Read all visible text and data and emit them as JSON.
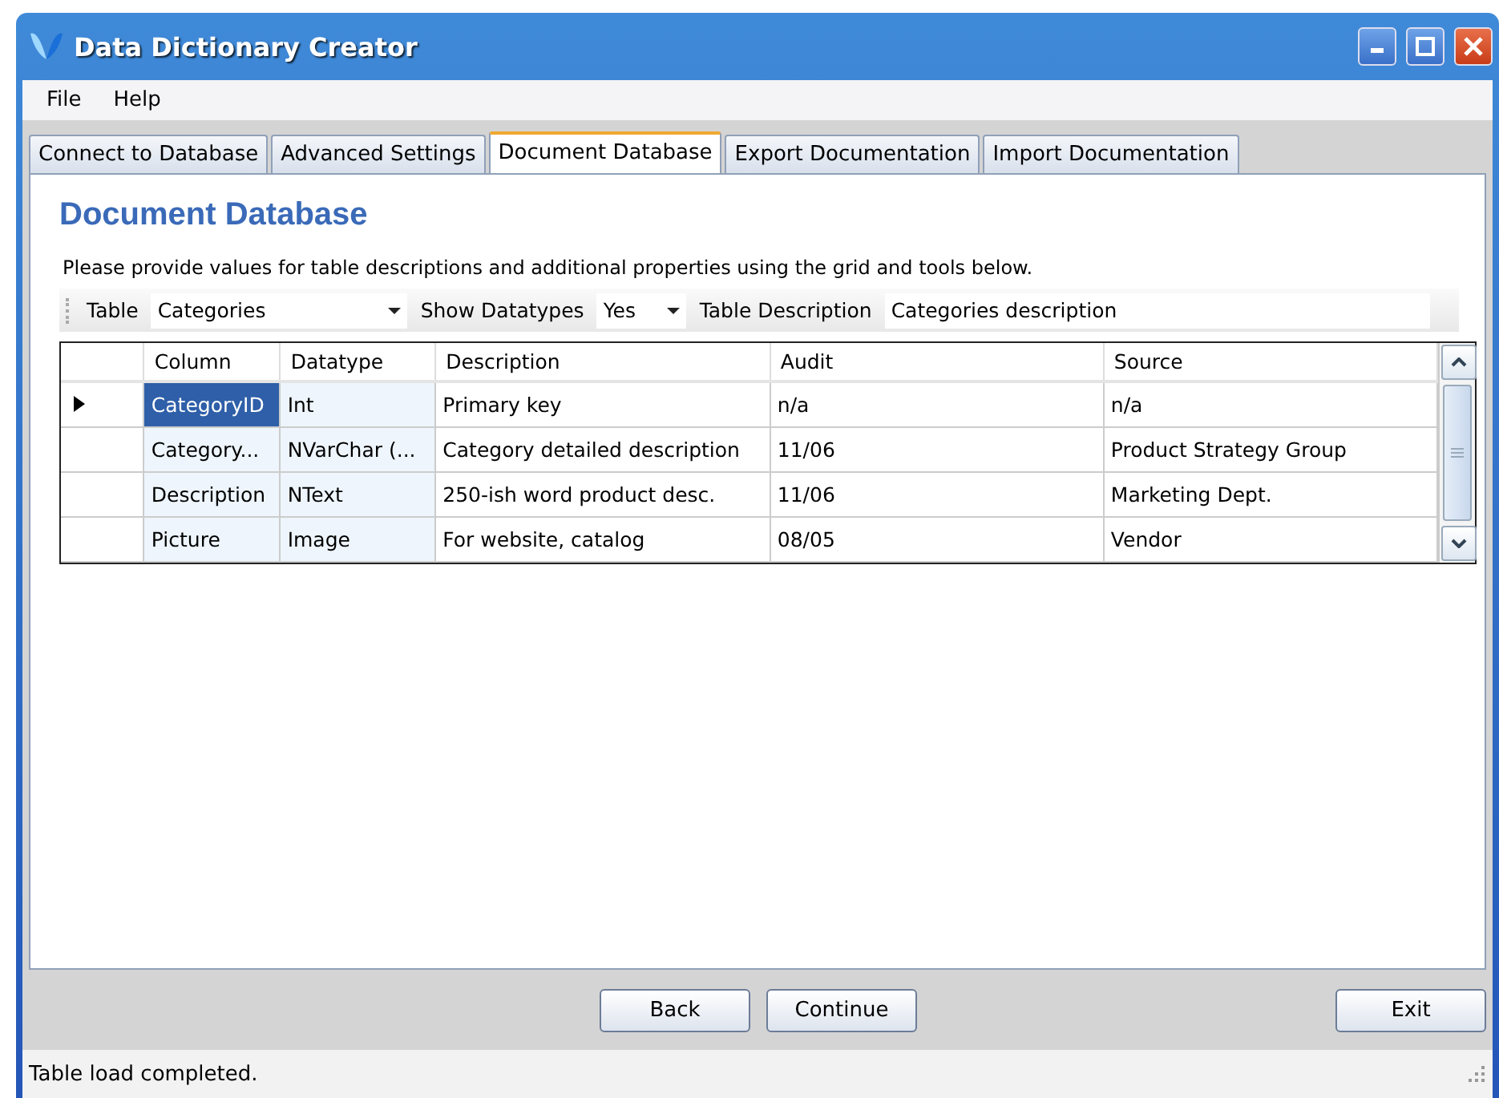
{
  "window": {
    "title": "Data Dictionary Creator"
  },
  "menu": [
    "File",
    "Help"
  ],
  "tabs": [
    {
      "label": "Connect to Database",
      "selected": false
    },
    {
      "label": "Advanced Settings",
      "selected": false
    },
    {
      "label": "Document Database",
      "selected": true
    },
    {
      "label": "Export Documentation",
      "selected": false
    },
    {
      "label": "Import Documentation",
      "selected": false
    }
  ],
  "heading": "Document Database",
  "instructions": "Please provide values for table descriptions and additional properties using the grid and tools below.",
  "toolbar": [
    {
      "kind": "combo",
      "label": "Table",
      "value": "Categories"
    },
    {
      "kind": "combo",
      "label": "Show Datatypes",
      "value": "Yes"
    },
    {
      "kind": "text",
      "label": "Table Description",
      "value": "Categories description"
    }
  ],
  "grid": {
    "columns": [
      "Column",
      "Datatype",
      "Description",
      "Audit",
      "Source"
    ],
    "rows": [
      {
        "selected": true,
        "cells": [
          "CategoryID",
          "Int",
          "Primary key",
          "n/a",
          "n/a"
        ]
      },
      {
        "selected": false,
        "cells": [
          "Category...",
          "NVarChar (...",
          "Category detailed description",
          "11/06",
          "Product Strategy Group"
        ]
      },
      {
        "selected": false,
        "cells": [
          "Description",
          "NText",
          "250-ish word product desc.",
          "11/06",
          "Marketing Dept."
        ]
      },
      {
        "selected": false,
        "cells": [
          "Picture",
          "Image",
          "For website, catalog",
          "08/05",
          "Vendor"
        ]
      }
    ]
  },
  "buttons": [
    {
      "kind": "nav",
      "label": "Back"
    },
    {
      "kind": "nav",
      "label": "Continue"
    },
    {
      "kind": "exit",
      "label": "Exit"
    }
  ],
  "status_bar": "Table load completed."
}
